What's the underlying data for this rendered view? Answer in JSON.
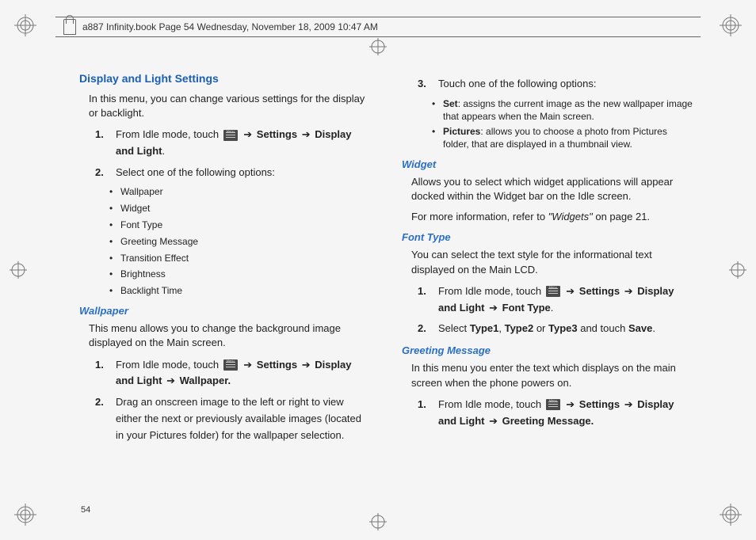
{
  "header": {
    "text": "a887 Infinity.book  Page 54  Wednesday, November 18, 2009  10:47 AM"
  },
  "page_number": "54",
  "left": {
    "h_main": "Display and Light Settings",
    "intro": "In this menu, you can change various settings for the display or backlight.",
    "step1_a": "From Idle mode, touch ",
    "step1_b": " ➔ ",
    "step1_settings": "Settings",
    "step1_c": " ➔ ",
    "step1_display": "Display and Light",
    "step1_end": ".",
    "step2": "Select one of the following options:",
    "opts": {
      "o1": "Wallpaper",
      "o2": "Widget",
      "o3": "Font Type",
      "o4": "Greeting Message",
      "o5": "Transition Effect",
      "o6": "Brightness",
      "o7": "Backlight Time"
    },
    "h_wallpaper": "Wallpaper",
    "wallpaper_intro": "This menu allows you to change the background image displayed on the Main screen.",
    "wp_step1_a": "From Idle mode, touch ",
    "wp_step1_b": " ➔ ",
    "wp_step1_settings": "Settings",
    "wp_step1_c": " ➔ ",
    "wp_step1_dl": "Display and Light",
    "wp_step1_d": " ➔ ",
    "wp_step1_wp": "Wallpaper.",
    "wp_step2": "Drag an onscreen image to the left or right to view either the next or previously available images (located in your Pictures folder) for the wallpaper selection."
  },
  "right": {
    "step3": "Touch one of the following options:",
    "set_label": "Set",
    "set_desc": ": assigns the current image as the new wallpaper image that appears when the Main screen.",
    "pic_label": "Pictures",
    "pic_desc": ": allows you to choose a photo from Pictures folder, that are displayed in a thumbnail view.",
    "h_widget": "Widget",
    "widget_p1": "Allows you to select which widget applications will appear docked within the Widget bar on the Idle screen.",
    "widget_p2a": "For more information, refer to ",
    "widget_p2b": "\"Widgets\"",
    "widget_p2c": "  on page 21.",
    "h_font": "Font Type",
    "font_intro": "You can select the text style for the informational text displayed on the Main LCD.",
    "ft_step1_a": "From Idle mode, touch ",
    "ft_step1_b": " ➔ ",
    "ft_step1_settings": "Settings",
    "ft_step1_c": " ➔ ",
    "ft_step1_dl": "Display and Light",
    "ft_step1_d": " ➔ ",
    "ft_step1_ft": "Font Type",
    "ft_step1_end": ".",
    "ft_step2_a": "Select ",
    "ft_t1": "Type1",
    "ft_sep1": ", ",
    "ft_t2": "Type2",
    "ft_sep2": " or ",
    "ft_t3": "Type3",
    "ft_step2_b": " and touch ",
    "ft_save": "Save",
    "ft_step2_end": ".",
    "h_greet": "Greeting Message",
    "greet_intro": "In this menu you enter the text which displays on the main screen when the phone powers on.",
    "gm_step1_a": "From Idle mode, touch ",
    "gm_step1_b": " ➔ ",
    "gm_step1_settings": "Settings",
    "gm_step1_c": " ➔ ",
    "gm_step1_dl": "Display and Light",
    "gm_step1_d": " ➔ ",
    "gm_step1_gm": "Greeting Message."
  }
}
